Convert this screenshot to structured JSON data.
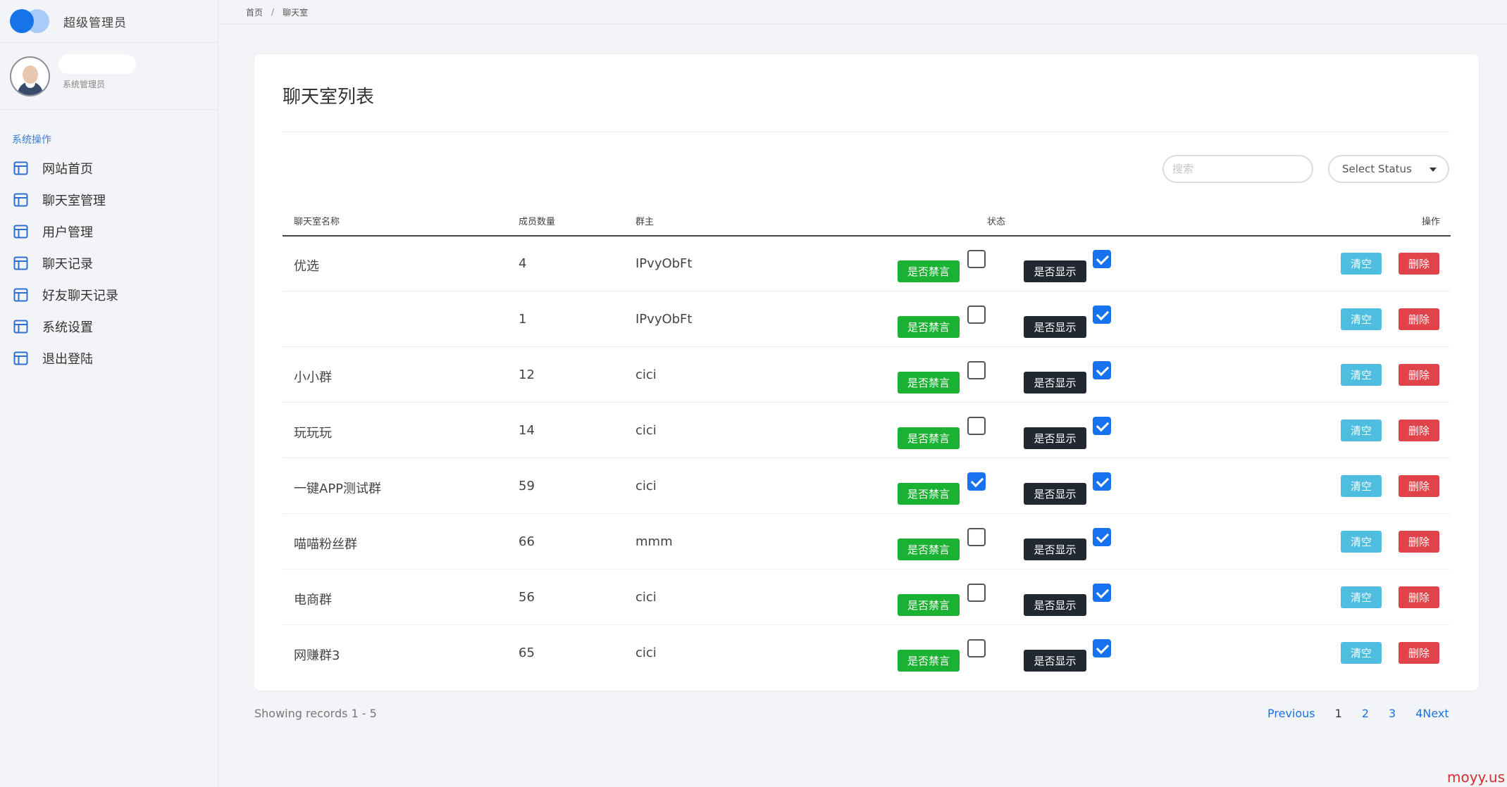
{
  "brand": {
    "title": "超级管理员"
  },
  "profile": {
    "role": "系统管理员"
  },
  "sidebar": {
    "section_title": "系统操作",
    "items": [
      {
        "label": "网站首页",
        "icon": "table-icon"
      },
      {
        "label": "聊天室管理",
        "icon": "table-icon"
      },
      {
        "label": "用户管理",
        "icon": "table-icon"
      },
      {
        "label": "聊天记录",
        "icon": "table-icon"
      },
      {
        "label": "好友聊天记录",
        "icon": "table-icon"
      },
      {
        "label": "系统设置",
        "icon": "table-icon"
      },
      {
        "label": "退出登陆",
        "icon": "table-icon"
      }
    ]
  },
  "breadcrumb": {
    "home": "首页",
    "separator": "/",
    "current": "聊天室"
  },
  "page": {
    "title": "聊天室列表",
    "search_placeholder": "搜索",
    "status_select": "Select Status"
  },
  "table": {
    "headers": {
      "name": "聊天室名称",
      "members": "成员数量",
      "owner": "群主",
      "status": "状态",
      "actions": "操作"
    },
    "rows": [
      {
        "name": "优选",
        "members": "4",
        "owner": "IPvyObFt",
        "mute_label": "是否禁言",
        "mute": false,
        "show_label": "是否显示",
        "show": true,
        "clear_label": "清空",
        "delete_label": "删除"
      },
      {
        "name": "",
        "members": "1",
        "owner": "IPvyObFt",
        "mute_label": "是否禁言",
        "mute": false,
        "show_label": "是否显示",
        "show": true,
        "clear_label": "清空",
        "delete_label": "删除"
      },
      {
        "name": "小小群",
        "members": "12",
        "owner": "cici",
        "mute_label": "是否禁言",
        "mute": false,
        "show_label": "是否显示",
        "show": true,
        "clear_label": "清空",
        "delete_label": "删除"
      },
      {
        "name": "玩玩玩",
        "members": "14",
        "owner": "cici",
        "mute_label": "是否禁言",
        "mute": false,
        "show_label": "是否显示",
        "show": true,
        "clear_label": "清空",
        "delete_label": "删除"
      },
      {
        "name": "一键APP测试群",
        "members": "59",
        "owner": "cici",
        "mute_label": "是否禁言",
        "mute": true,
        "show_label": "是否显示",
        "show": true,
        "clear_label": "清空",
        "delete_label": "删除"
      },
      {
        "name": "喵喵粉丝群",
        "members": "66",
        "owner": "mmm",
        "mute_label": "是否禁言",
        "mute": false,
        "show_label": "是否显示",
        "show": true,
        "clear_label": "清空",
        "delete_label": "删除"
      },
      {
        "name": "电商群",
        "members": "56",
        "owner": "cici",
        "mute_label": "是否禁言",
        "mute": false,
        "show_label": "是否显示",
        "show": true,
        "clear_label": "清空",
        "delete_label": "删除"
      },
      {
        "name": "网赚群3",
        "members": "65",
        "owner": "cici",
        "mute_label": "是否禁言",
        "mute": false,
        "show_label": "是否显示",
        "show": true,
        "clear_label": "清空",
        "delete_label": "删除"
      }
    ]
  },
  "footer": {
    "records_info": "Showing records 1 - 5",
    "pagination": {
      "previous": "Previous",
      "pages": [
        "1",
        "2",
        "3",
        "4"
      ],
      "current": "1",
      "next": "Next"
    }
  },
  "watermark": "moyy.us",
  "colors": {
    "accent": "#1a73e8",
    "mute_button": "#1bb233",
    "show_button": "#222831",
    "clear_button": "#4fbde0",
    "delete_button": "#e0444a"
  }
}
